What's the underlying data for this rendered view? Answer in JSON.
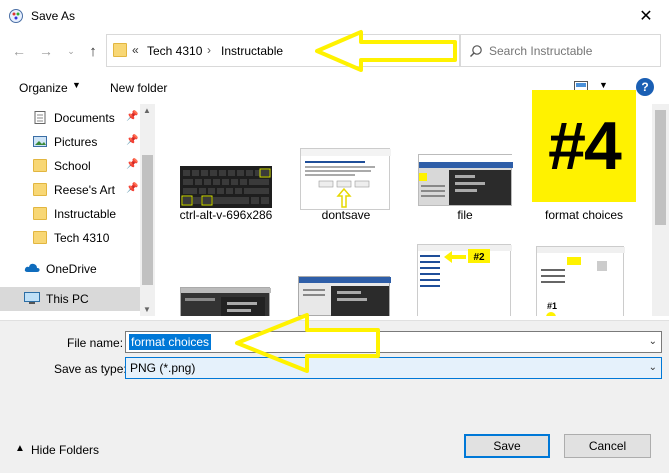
{
  "window": {
    "title": "Save As",
    "close_glyph": "✕"
  },
  "address": {
    "overflow": "«",
    "crumbs": [
      "Tech 4310",
      "Instructable"
    ],
    "separator": "›"
  },
  "search": {
    "placeholder": "Search Instructable"
  },
  "toolbar": {
    "organize": "Organize",
    "new_folder": "New folder",
    "help": "?"
  },
  "nav": {
    "quick_access": [
      {
        "label": "Documents",
        "icon": "documents-icon",
        "pinned": true
      },
      {
        "label": "Pictures",
        "icon": "pictures-icon",
        "pinned": true
      },
      {
        "label": "School",
        "icon": "folder-icon",
        "pinned": true
      },
      {
        "label": "Reese's Art",
        "icon": "folder-icon",
        "pinned": true
      },
      {
        "label": "Instructable",
        "icon": "folder-icon",
        "pinned": false
      },
      {
        "label": "Tech 4310",
        "icon": "folder-icon",
        "pinned": false
      }
    ],
    "onedrive": "OneDrive",
    "this_pc": "This PC"
  },
  "files": {
    "row1": [
      "ctrl-alt-v-696x286",
      "dontsave",
      "file",
      "format choices"
    ],
    "row2_labels": {
      "a": "#2",
      "b": "#1"
    }
  },
  "form": {
    "file_name_label": "File name:",
    "file_name_value": "format choices",
    "save_type_label": "Save as type:",
    "save_type_value": "PNG (*.png)"
  },
  "footer": {
    "hide_folders": "Hide Folders",
    "save": "Save",
    "cancel": "Cancel"
  },
  "annotation": {
    "badge": "#4",
    "color": "#fff200"
  },
  "colors": {
    "accent": "#0078d7",
    "selection": "#0078d7",
    "folder": "#f8d775"
  }
}
